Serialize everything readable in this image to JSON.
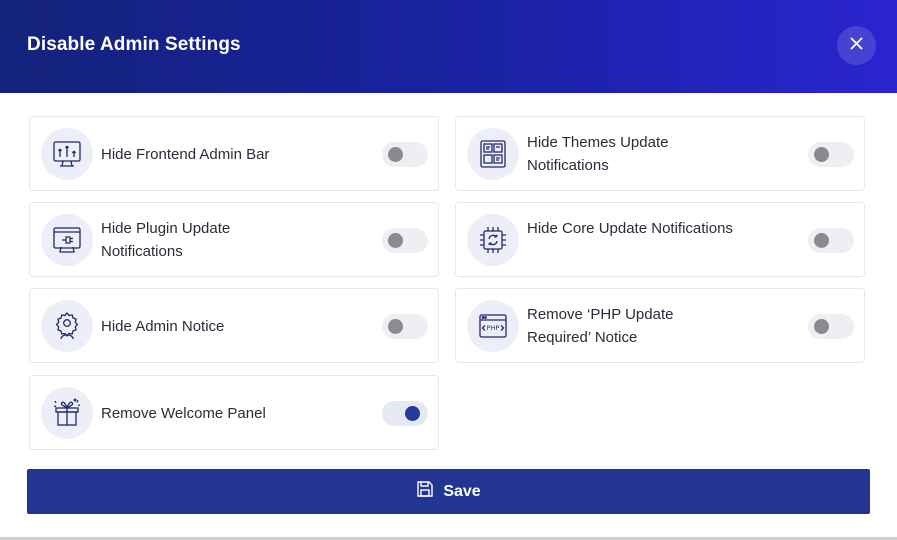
{
  "dialog": {
    "title": "Disable Admin Settings",
    "close_icon": "close-icon",
    "accent_color": "#233593",
    "header_gradient": [
      "#13227a",
      "#2a24d0"
    ]
  },
  "settings": [
    {
      "label": "Hide Frontend Admin Bar",
      "icon": "admin-bar-chart-icon",
      "enabled": false
    },
    {
      "label": "Hide Themes Update Notifications",
      "icon": "themes-grid-icon",
      "enabled": false
    },
    {
      "label": "Hide Plugin Update Notifications",
      "icon": "plugin-update-icon",
      "enabled": false
    },
    {
      "label": "Hide Core Update Notifications",
      "icon": "core-update-chip-icon",
      "enabled": false
    },
    {
      "label": "Hide Admin Notice",
      "icon": "admin-user-gear-icon",
      "enabled": false
    },
    {
      "label": "Remove ‘PHP Update Required’ Notice",
      "icon": "php-window-icon",
      "enabled": false
    },
    {
      "label": "Remove Welcome Panel",
      "icon": "welcome-gift-icon",
      "enabled": true
    }
  ],
  "footer": {
    "save_label": "Save",
    "save_icon": "floppy-disk-icon"
  }
}
